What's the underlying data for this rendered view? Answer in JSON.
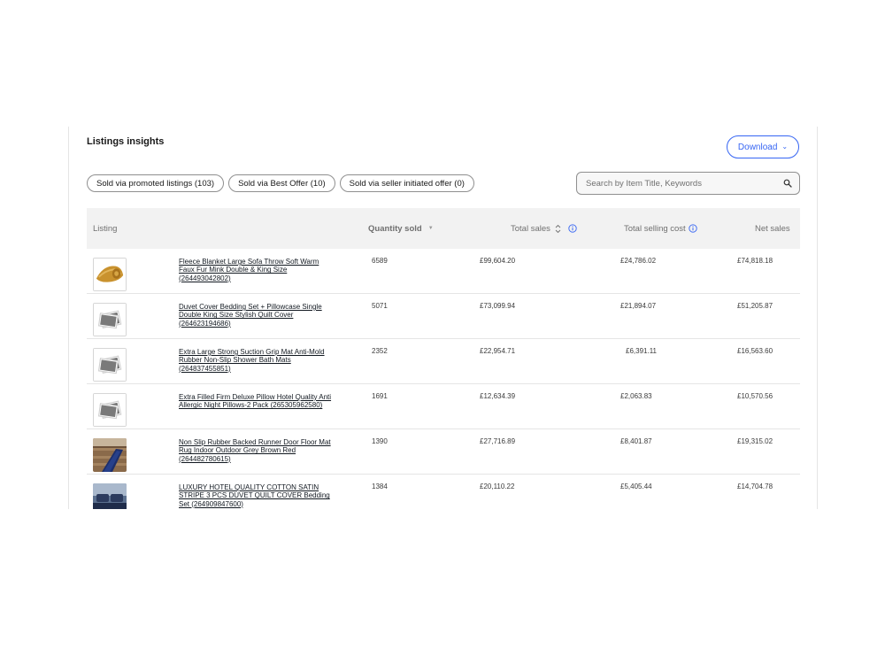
{
  "panel": {
    "title": "Listings insights",
    "download_label": "Download"
  },
  "filters": [
    {
      "label": "Sold via promoted listings (103)"
    },
    {
      "label": "Sold via Best Offer (10)"
    },
    {
      "label": "Sold via seller initiated offer (0)"
    }
  ],
  "search": {
    "placeholder": "Search by Item Title, Keywords",
    "icon": "search-icon"
  },
  "table": {
    "headers": {
      "listing": "Listing",
      "quantity_sold": "Quantity sold",
      "total_sales": "Total sales",
      "total_selling_cost": "Total selling cost",
      "net_sales": "Net sales"
    },
    "rows": [
      {
        "title": "Fleece Blanket Large Sofa Throw Soft Warm Faux Fur Mink Double & King Size (264493042802)",
        "quantity": "6589",
        "total_sales": "£99,604.20",
        "selling_cost": "£24,786.02",
        "net_sales": "£74,818.18",
        "thumb": "blanket-photo"
      },
      {
        "title": "Duvet Cover Bedding Set + Pillowcase Single Double King Size Stylish Quilt Cover (264623194686)",
        "quantity": "5071",
        "total_sales": "£73,099.94",
        "selling_cost": "£21,894.07",
        "net_sales": "£51,205.87",
        "thumb": "placeholder-image"
      },
      {
        "title": "Extra Large Strong Suction Grip Mat Anti-Mold Rubber Non-Slip Shower Bath Mats (264837455851)",
        "quantity": "2352",
        "total_sales": "£22,954.71",
        "selling_cost": "£6,391.11",
        "net_sales": "£16,563.60",
        "thumb": "placeholder-image"
      },
      {
        "title": "Extra Filled Firm Deluxe Pillow Hotel Quality Anti Allergic Night Pillows-2 Pack (265305962580)",
        "quantity": "1691",
        "total_sales": "£12,634.39",
        "selling_cost": "£2,063.83",
        "net_sales": "£10,570.56",
        "thumb": "placeholder-image"
      },
      {
        "title": "Non Slip Rubber Backed Runner Door Floor Mat Rug Indoor Outdoor Grey Brown Red (264482780615)",
        "quantity": "1390",
        "total_sales": "£27,716.89",
        "selling_cost": "£8,401.87",
        "net_sales": "£19,315.02",
        "thumb": "runner-rug-photo"
      },
      {
        "title": "LUXURY HOTEL QUALITY COTTON SATIN STRIPE 3 PCS DUVET QUILT COVER Bedding Set (264909847600)",
        "quantity": "1384",
        "total_sales": "£20,110.22",
        "selling_cost": "£5,405.44",
        "net_sales": "£14,704.78",
        "thumb": "bedding-photo"
      }
    ]
  },
  "colors": {
    "accent": "#3665f3",
    "header_bg": "#f2f2f2",
    "border": "#8f8f8f"
  }
}
